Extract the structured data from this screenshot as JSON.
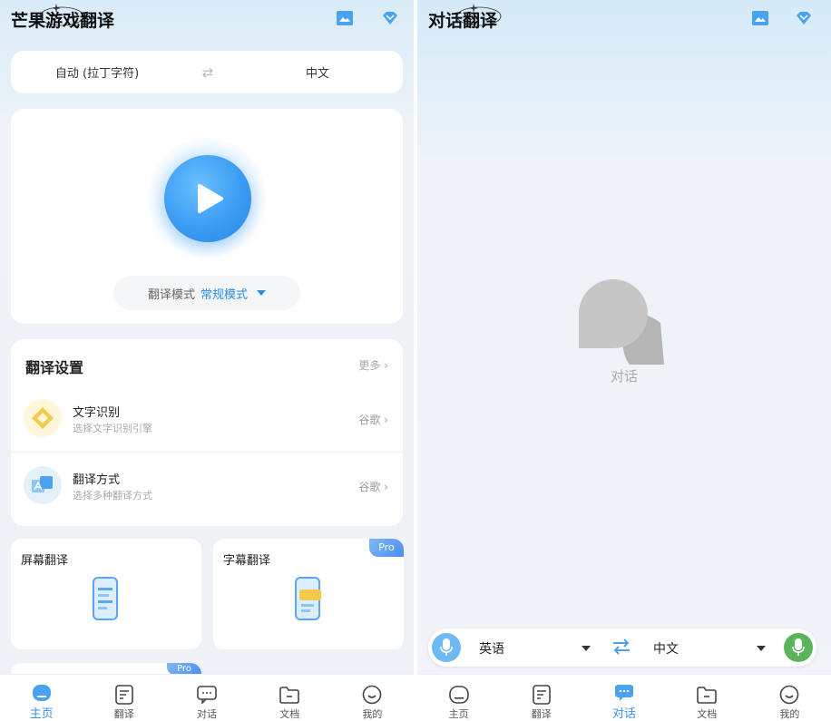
{
  "left": {
    "title": "芒果游戏翻译",
    "source_lang": "自动 (拉丁字符)",
    "swap_symbol": "⇄",
    "target_lang": "中文",
    "mode_label": "翻译模式",
    "mode_value": "常规模式",
    "settings": {
      "title": "翻译设置",
      "more": "更多 ›",
      "rows": [
        {
          "title": "文字识别",
          "subtitle": "选择文字识别引擎",
          "value": "谷歌 ›"
        },
        {
          "title": "翻译方式",
          "subtitle": "选择多种翻译方式",
          "value": "谷歌 ›"
        }
      ]
    },
    "features": [
      {
        "title": "屏幕翻译",
        "pro": ""
      },
      {
        "title": "字幕翻译",
        "pro": "Pro"
      },
      {
        "title": "",
        "pro": "Pro"
      }
    ],
    "nav": [
      "主页",
      "翻译",
      "对话",
      "文档",
      "我的"
    ]
  },
  "right": {
    "title": "对话翻译",
    "empty_label": "对话",
    "lang_a": "英语",
    "lang_b": "中文",
    "nav": [
      "主页",
      "翻译",
      "对话",
      "文档",
      "我的"
    ]
  },
  "colors": {
    "accent": "#3b8ff0",
    "mic_left": "#6fb8f5",
    "mic_right": "#5db35c",
    "pro_badge": "#4a8ef0"
  }
}
